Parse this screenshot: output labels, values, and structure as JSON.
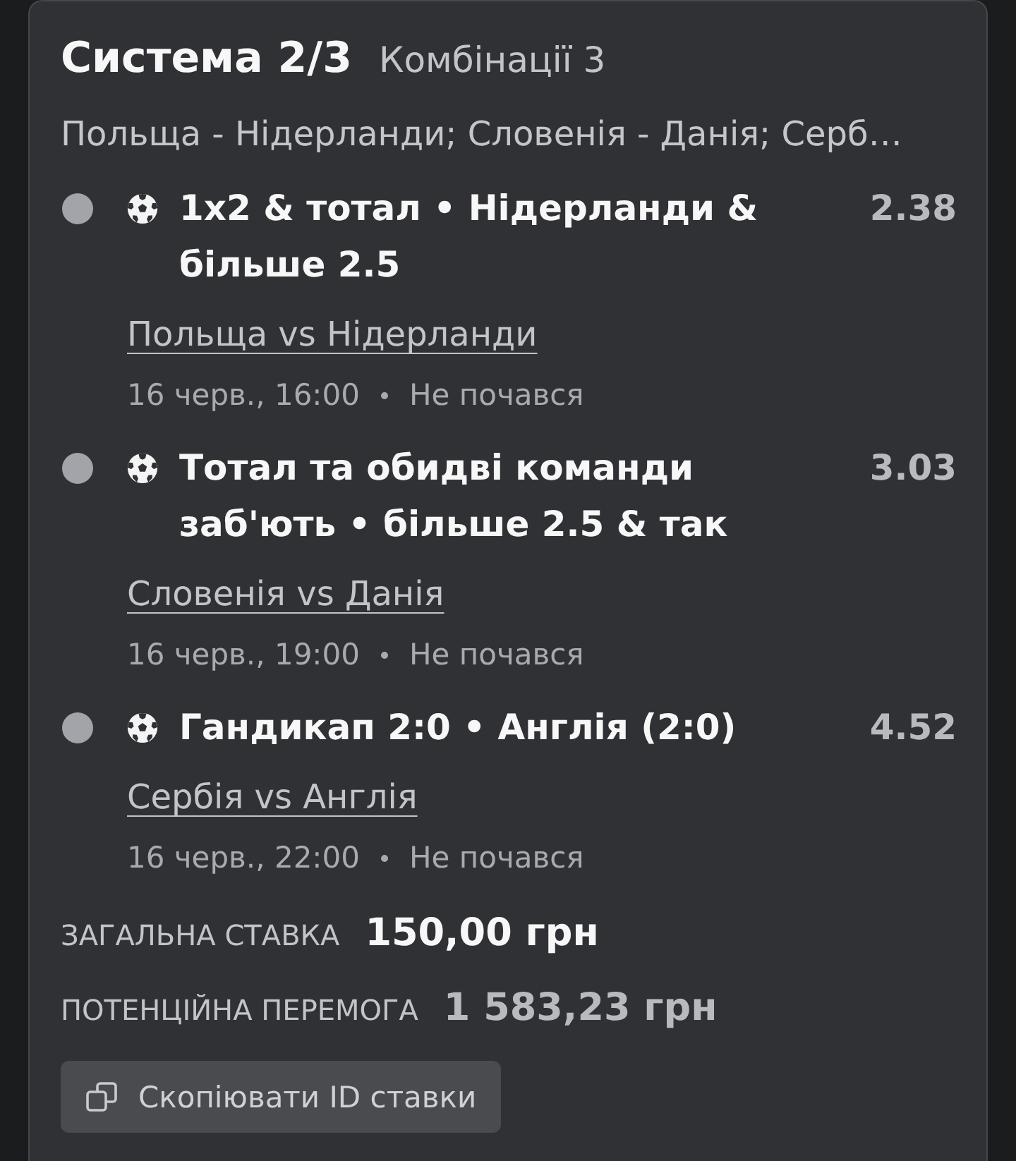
{
  "bet": {
    "title": "Система 2/3",
    "combinations": "Комбінації 3",
    "events_summary": "Польща - Нідерланди; Словенія - Данія; Серб…"
  },
  "selections": [
    {
      "color": "#a3a4aa",
      "title": "1x2 & тотал • Нідерланди & більше 2.5",
      "odds": "2.38",
      "match": "Польща vs Нідерланди",
      "date": "16 черв., 16:00",
      "status": "Не почався"
    },
    {
      "color": "#a3a4aa",
      "title": "Тотал та обидві команди заб'ють • більше 2.5 & так",
      "odds": "3.03",
      "match": "Словенія vs Данія",
      "date": "16 черв., 19:00",
      "status": "Не почався"
    },
    {
      "color": "#a3a4aa",
      "title": "Гандикап 2:0 • Англія (2:0)",
      "odds": "4.52",
      "match": "Сербія vs Англія",
      "date": "16 черв., 22:00",
      "status": "Не почався"
    }
  ],
  "totals": [
    {
      "kind": "stake",
      "label": "ЗАГАЛЬНА СТАВКА",
      "value": "150,00 грн"
    },
    {
      "kind": "payout",
      "label": "ПОТЕНЦІЙНА ПЕРЕМОГА",
      "value": "1 583,23 грн"
    }
  ],
  "copy_button": {
    "label": "Скопіювати ID ставки"
  }
}
